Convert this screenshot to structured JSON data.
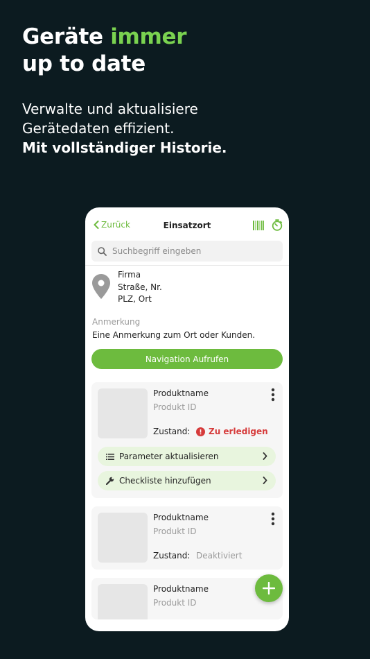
{
  "headline": {
    "line1_prefix": "Geräte ",
    "line1_accent": "immer",
    "line2": "up to date"
  },
  "subtext": {
    "line1": "Verwalte und aktualisiere",
    "line2": "Gerätedaten effizient.",
    "line3": "Mit vollständiger Historie."
  },
  "app": {
    "back_label": "Zurück",
    "title": "Einsatzort",
    "search_placeholder": "Suchbegriff eingeben",
    "address": {
      "company": "Firma",
      "street": "Straße, Nr.",
      "city": "PLZ, Ort"
    },
    "note_label": "Anmerkung",
    "note_text": "Eine Anmerkung zum Ort oder Kunden.",
    "nav_button": "Navigation Aufrufen",
    "products": [
      {
        "name": "Produktname",
        "id": "Produkt ID",
        "state_label": "Zustand:",
        "state": "Zu erledigen",
        "actions": [
          "Parameter aktualisieren",
          "Checkliste hinzufügen"
        ]
      },
      {
        "name": "Produktname",
        "id": "Produkt ID",
        "state_label": "Zustand:",
        "state": "Deaktiviert"
      },
      {
        "name": "Produktname",
        "id": "Produkt ID"
      }
    ]
  },
  "colors": {
    "background": "#0c1b20",
    "accent": "#7ad250",
    "brand_green": "#6dbb3e",
    "status_red": "#d63b3b"
  },
  "icons": [
    "chevron-left-icon",
    "barcode-icon",
    "timer-icon",
    "search-icon",
    "location-pin-icon",
    "kebab-menu-icon",
    "alert-icon",
    "list-icon",
    "wrench-icon",
    "chevron-right-icon",
    "plus-icon"
  ]
}
